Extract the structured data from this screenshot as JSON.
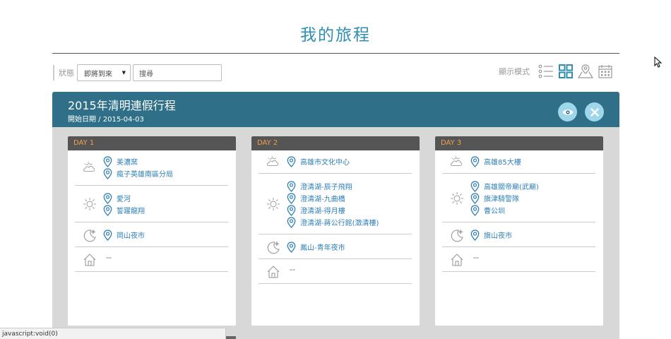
{
  "page": {
    "title": "我的旅程"
  },
  "filter": {
    "status_label": "狀態",
    "status_value": "即將到來",
    "search_placeholder": "搜尋"
  },
  "view_mode": {
    "label": "顯示模式",
    "modes": [
      "list-icon",
      "grid-icon",
      "map-icon",
      "calendar-icon"
    ],
    "active": "grid-icon"
  },
  "trip": {
    "title": "2015年清明連假行程",
    "start_date": "開始日期 / 2015-04-03"
  },
  "days": [
    {
      "label": "DAY 1",
      "slots": [
        {
          "period": "morning",
          "places": [
            "美濃窯",
            "瘋子英雄南區分局"
          ]
        },
        {
          "period": "afternoon",
          "places": [
            "愛河",
            "誓躍龍翔"
          ]
        },
        {
          "period": "night",
          "places": [
            "岡山夜市"
          ]
        },
        {
          "period": "lodging",
          "places": [],
          "empty_text": "--"
        }
      ]
    },
    {
      "label": "DAY 2",
      "slots": [
        {
          "period": "morning",
          "places": [
            "高雄市文化中心"
          ]
        },
        {
          "period": "afternoon",
          "places": [
            "澄清湖-辰子飛翔",
            "澄清湖-九曲橋",
            "澄清湖-得月樓",
            "澄清湖-蔣公行館(澂清樓)"
          ]
        },
        {
          "period": "night",
          "places": [
            "鳳山-青年夜市"
          ]
        },
        {
          "period": "lodging",
          "places": [],
          "empty_text": "--"
        }
      ]
    },
    {
      "label": "DAY 3",
      "slots": [
        {
          "period": "morning",
          "places": [
            "高雄85大樓"
          ]
        },
        {
          "period": "afternoon",
          "places": [
            "高雄關帝廟(武廟)",
            "旗津騎警隊",
            "曹公圳"
          ]
        },
        {
          "period": "night",
          "places": [
            "旗山夜市"
          ]
        },
        {
          "period": "lodging",
          "places": [],
          "empty_text": "--"
        }
      ]
    }
  ],
  "browser_status": "javascript:void(0)",
  "colors": {
    "accent": "#2f8fb0",
    "trip_header": "#2f6f87",
    "day_label": "#f0a24a",
    "place_link": "#2f7fb5"
  }
}
